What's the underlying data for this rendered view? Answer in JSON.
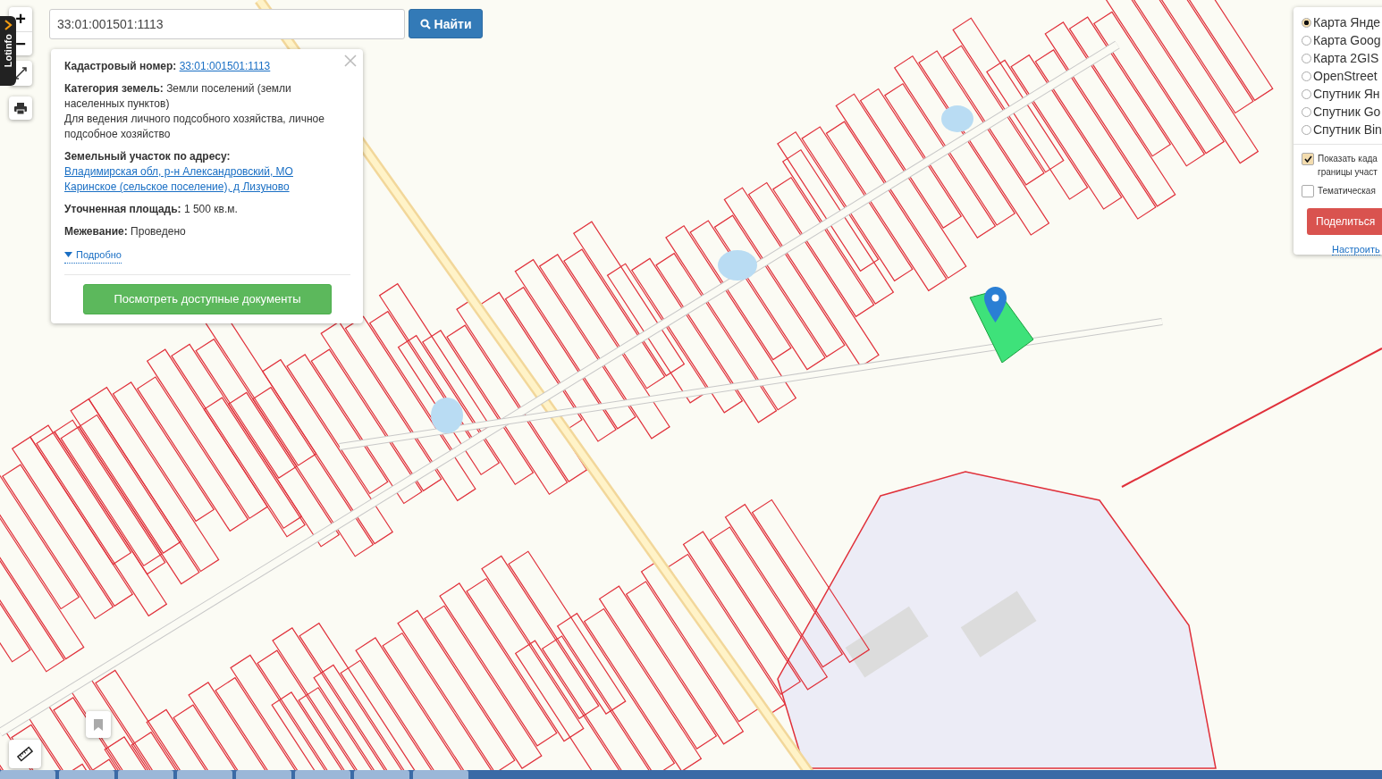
{
  "side_tab": {
    "label": "Lotinfo"
  },
  "zoom": {
    "plus": "+",
    "minus": "−"
  },
  "search": {
    "value": "33:01:001501:1113",
    "button": "Найти"
  },
  "popup": {
    "fields": [
      {
        "kind": "link",
        "label": "Кадастровый номер:",
        "value": "33:01:001501:1113"
      },
      {
        "kind": "text",
        "label": "Категория земель:",
        "value": "Земли поселений (земли населенных пунктов)",
        "note": "Для ведения личного подсобного хозяйства, личное подсобное хозяйство"
      },
      {
        "kind": "link",
        "label": "Земельный участок по адресу:",
        "value": "Владимирская обл, р-н Александровский, МО Каринское (сельское поселение), д Лизуново"
      },
      {
        "kind": "text",
        "label": "Уточненная площадь:",
        "value": "1 500 кв.м."
      },
      {
        "kind": "text",
        "label": "Межевание:",
        "value": "Проведено"
      }
    ],
    "more": {
      "label": "Подробно",
      "expanded": false
    },
    "button": "Посмотреть доступные документы"
  },
  "layers": [
    {
      "label": "Карта Янде",
      "selected": true
    },
    {
      "label": "Карта Goog",
      "selected": false
    },
    {
      "label": "Карта 2GIS",
      "selected": false
    },
    {
      "label": "OpenStreet",
      "selected": false
    },
    {
      "label": "Спутник Ян",
      "selected": false
    },
    {
      "label": "Спутник Go",
      "selected": false
    },
    {
      "label": "Спутник Bin",
      "selected": false
    }
  ],
  "options": [
    {
      "label": "Показать када\nграницы участ",
      "checked": true
    },
    {
      "label": "Тематическая",
      "checked": false
    }
  ],
  "share_button": "Поделиться",
  "settings_link": "Настроить"
}
